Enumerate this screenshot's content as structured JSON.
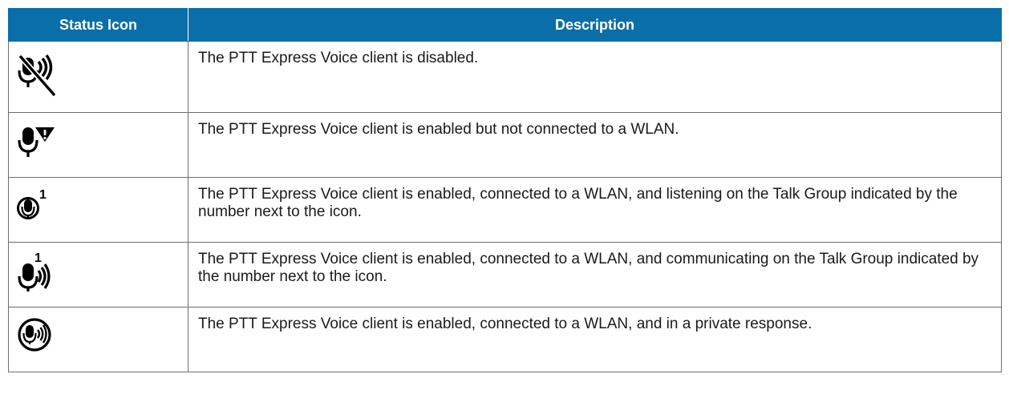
{
  "table": {
    "headers": {
      "icon": "Status Icon",
      "description": "Description"
    },
    "rows": [
      {
        "icon": "mic-with-waves-disabled-icon",
        "description": "The PTT Express Voice client is disabled."
      },
      {
        "icon": "mic-with-warning-icon",
        "description": "The PTT Express Voice client is enabled but not connected to a WLAN."
      },
      {
        "icon": "mic-listening-talk-group-icon",
        "talk_group": "1",
        "description": "The PTT Express Voice client is enabled, connected to a WLAN, and listening on the Talk Group indicated by the number next to the icon."
      },
      {
        "icon": "mic-communicating-talk-group-icon",
        "talk_group": "1",
        "description": "The PTT Express Voice client is enabled, connected to a WLAN, and communicating on the Talk Group indicated by the number next to the icon."
      },
      {
        "icon": "mic-private-response-icon",
        "description": "The PTT Express Voice client is enabled, connected to a WLAN, and in a private response."
      }
    ]
  },
  "colors": {
    "header_background": "#0a6fa8",
    "header_text": "#ffffff",
    "border": "#6e6e6e",
    "icon": "#000000"
  }
}
